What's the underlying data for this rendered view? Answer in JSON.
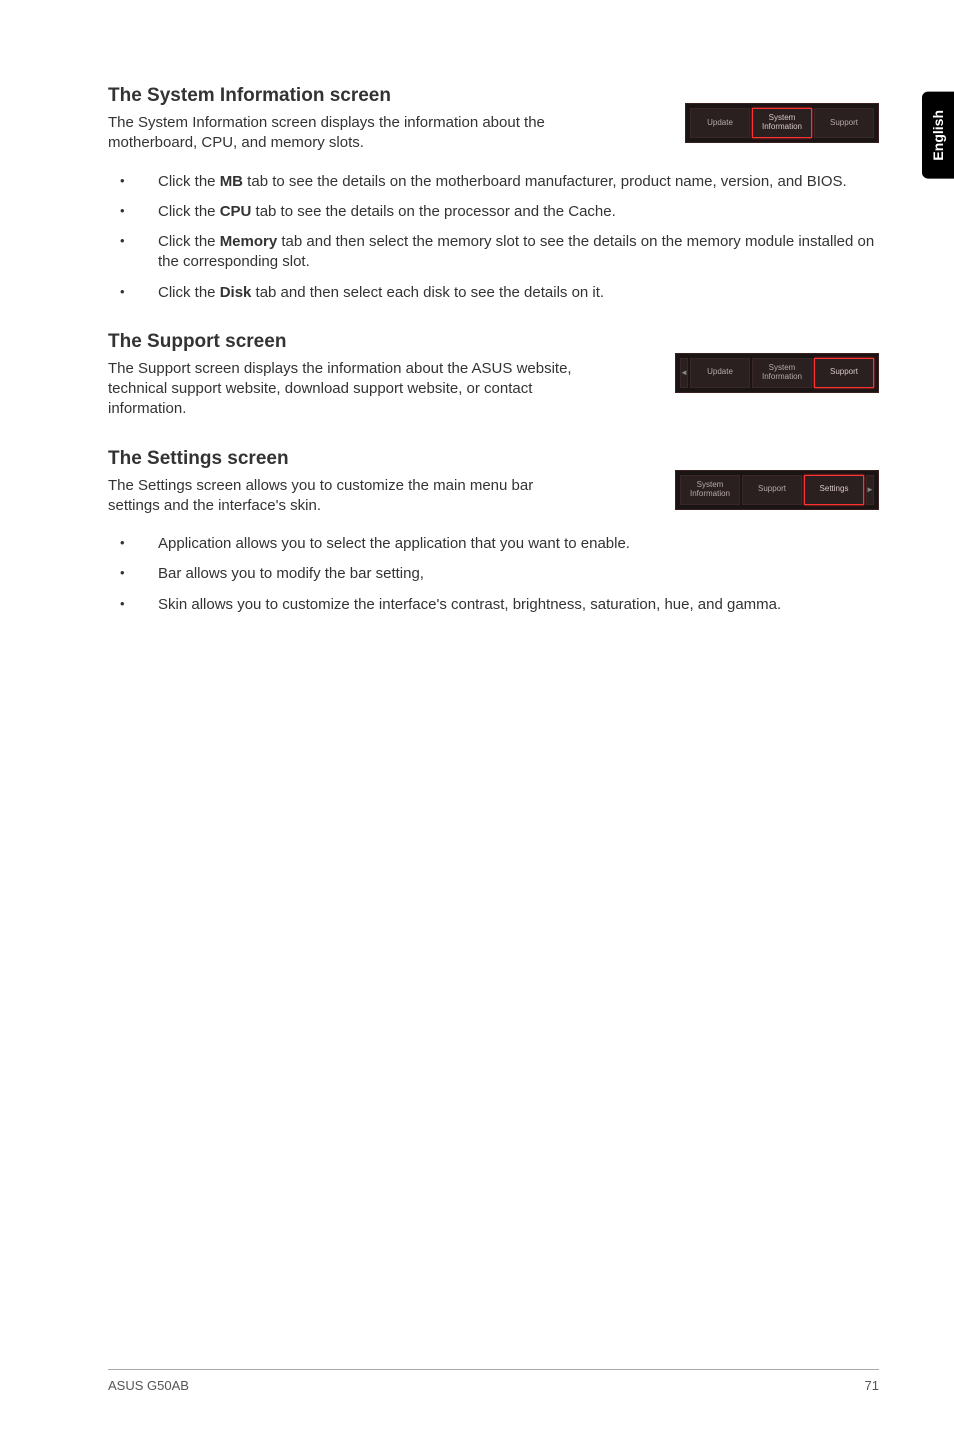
{
  "sideTab": "English",
  "sections": {
    "sysinfo": {
      "heading": "The System Information screen",
      "desc": "The System Information screen displays the information about the motherboard, CPU, and memory slots.",
      "tabs": {
        "t1": "Update",
        "t2": "System\nInformation",
        "t3": "Support"
      },
      "bullets": {
        "b1a": "Click the ",
        "b1b": "MB",
        "b1c": " tab to see the details on the motherboard manufacturer, product name, version, and BIOS.",
        "b2a": "Click the ",
        "b2b": "CPU",
        "b2c": " tab to see the details on the processor and the Cache.",
        "b3a": "Click the ",
        "b3b": "Memory",
        "b3c": " tab and then select the memory slot to see the details on the memory module installed on the corresponding slot.",
        "b4a": "Click the ",
        "b4b": "Disk",
        "b4c": " tab and then select each disk to see the details on it."
      }
    },
    "support": {
      "heading": "The Support screen",
      "desc": "The Support screen displays the information about the ASUS website, technical support website, download support website, or contact information.",
      "tabs": {
        "t1": "Update",
        "t2": "System\nInformation",
        "t3": "Support"
      }
    },
    "settings": {
      "heading": "The Settings screen",
      "desc": "The Settings screen allows you to customize the main menu bar settings and the interface's skin.",
      "tabs": {
        "t1": "System\nInformation",
        "t2": "Support",
        "t3": "Settings"
      },
      "bullets": {
        "b1": "Application allows you to select the application that you want to enable.",
        "b2": "Bar allows you to modify the bar setting,",
        "b3": "Skin allows you to customize the interface's contrast, brightness, saturation, hue, and gamma."
      }
    }
  },
  "footer": {
    "left": "ASUS G50AB",
    "right": "71"
  }
}
